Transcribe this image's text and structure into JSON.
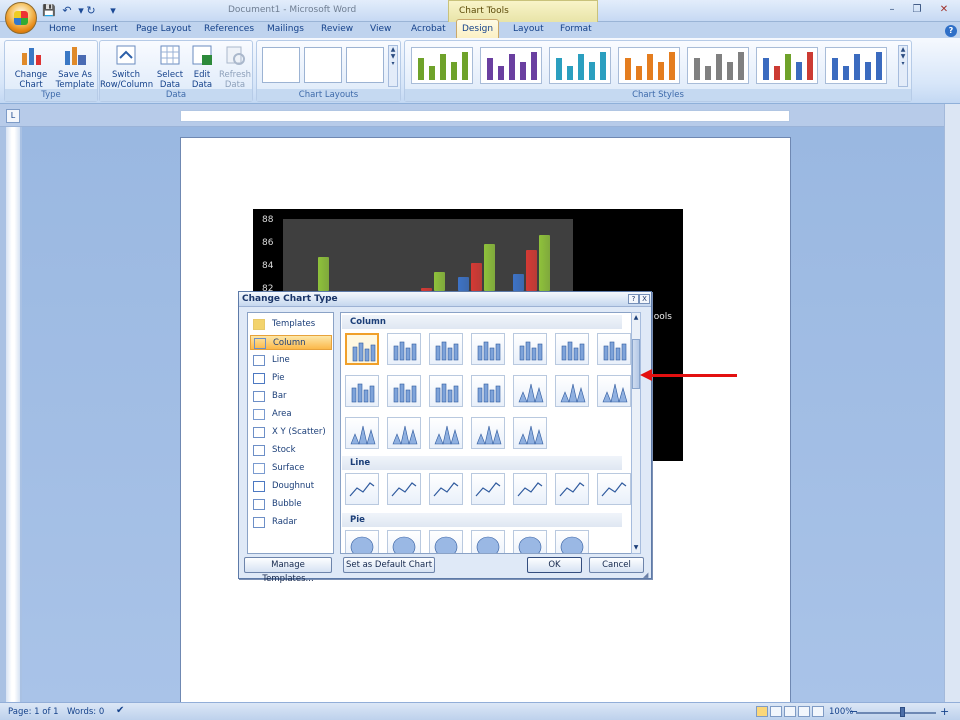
{
  "window": {
    "title": "Document1 - Microsoft Word",
    "contextual_tab_group": "Chart Tools",
    "minimize": "–",
    "restore": "❐",
    "close": "✕",
    "help": "?"
  },
  "quick_access": {
    "save": "💾",
    "undo": "↶",
    "redo": "↻",
    "customize": "▾"
  },
  "tabs": [
    "Home",
    "Insert",
    "Page Layout",
    "References",
    "Mailings",
    "Review",
    "View",
    "Acrobat",
    "Design",
    "Layout",
    "Format"
  ],
  "active_tab": "Design",
  "ribbon": {
    "type_group": {
      "label": "Type",
      "change_chart_type": "Change\nChart Type",
      "change_chart_type_l1": "Change",
      "change_chart_type_l2": "Chart Type",
      "save_as_template_l1": "Save As",
      "save_as_template_l2": "Template"
    },
    "data_group": {
      "label": "Data",
      "switch_l1": "Switch",
      "switch_l2": "Row/Column",
      "select_l1": "Select",
      "select_l2": "Data",
      "edit_l1": "Edit",
      "edit_l2": "Data",
      "refresh_l1": "Refresh",
      "refresh_l2": "Data"
    },
    "layouts_group": {
      "label": "Chart Layouts"
    },
    "styles_group": {
      "label": "Chart Styles",
      "style_colors": [
        "#6fa22a",
        "#6a3fa0",
        "#2b9fbf",
        "#e47d1f",
        "#808080",
        "#cc3b33",
        "#3b6bbf"
      ]
    }
  },
  "ruler": {
    "left_button": "L"
  },
  "chart": {
    "type": "bar",
    "y_ticks": [
      "88",
      "86",
      "84",
      "82"
    ],
    "legend_fragment": "hools"
  },
  "chart_data": {
    "type": "bar",
    "title": "",
    "ylim": [
      80,
      88
    ],
    "y_ticks": [
      82,
      84,
      86,
      88
    ],
    "series": [
      {
        "color": "#3d73c7",
        "values": [
          null,
          null,
          83,
          83.2
        ]
      },
      {
        "color": "#d63a34",
        "values": [
          null,
          82,
          84.2,
          85.3
        ]
      },
      {
        "color": "#8fc23b",
        "values": [
          84.7,
          83.4,
          85.8,
          86.6
        ]
      }
    ]
  },
  "dialog": {
    "title": "Change Chart Type",
    "help_btn": "?",
    "close_btn": "X",
    "chart_types": [
      "Templates",
      "Column",
      "Line",
      "Pie",
      "Bar",
      "Area",
      "X Y (Scatter)",
      "Stock",
      "Surface",
      "Doughnut",
      "Bubble",
      "Radar"
    ],
    "selected_type": "Column",
    "sections": {
      "column": "Column",
      "line": "Line",
      "pie": "Pie"
    },
    "manage_templates": "Manage Templates...",
    "set_default": "Set as Default Chart",
    "ok": "OK",
    "cancel": "Cancel"
  },
  "status": {
    "page": "Page: 1 of 1",
    "words": "Words: 0",
    "zoom": "100%",
    "zoom_out": "−",
    "zoom_in": "+"
  }
}
